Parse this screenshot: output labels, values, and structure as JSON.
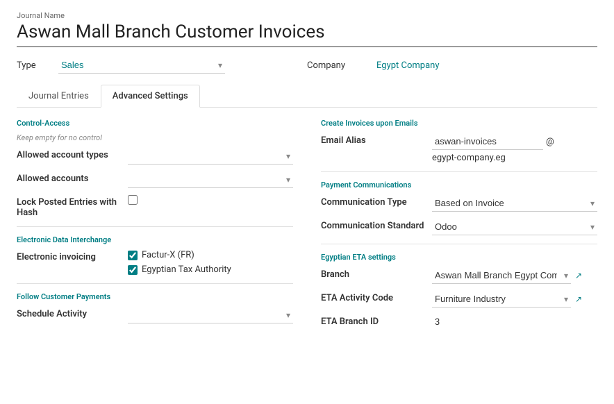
{
  "header": {
    "journal_name_label": "Journal Name",
    "journal_title": "Aswan Mall Branch Customer Invoices"
  },
  "type_row": {
    "type_label": "Type",
    "type_value": "Sales",
    "company_label": "Company",
    "company_value": "Egypt Company"
  },
  "tabs": [
    {
      "id": "journal-entries",
      "label": "Journal Entries",
      "active": false
    },
    {
      "id": "advanced-settings",
      "label": "Advanced Settings",
      "active": true
    }
  ],
  "left_panel": {
    "control_access": {
      "section_title": "Control-Access",
      "subtitle": "Keep empty for no control",
      "allowed_account_types_label": "Allowed account types",
      "allowed_accounts_label": "Allowed accounts",
      "lock_posted_label": "Lock Posted Entries with Hash",
      "lock_posted_checked": false
    },
    "edi": {
      "section_title": "Electronic Data Interchange",
      "electronic_invoicing_label": "Electronic invoicing",
      "options": [
        {
          "label": "Factur-X (FR)",
          "checked": true
        },
        {
          "label": "Egyptian Tax Authority",
          "checked": true
        }
      ]
    },
    "follow_customer": {
      "section_title": "Follow Customer Payments",
      "schedule_activity_label": "Schedule Activity"
    }
  },
  "right_panel": {
    "create_invoices": {
      "section_title": "Create Invoices upon Emails",
      "email_alias_label": "Email Alias",
      "email_alias_value": "aswan-invoices",
      "at_symbol": "@",
      "email_domain": "egypt-company.eg"
    },
    "payment_communications": {
      "section_title": "Payment Communications",
      "communication_type_label": "Communication Type",
      "communication_type_value": "Based on Invoice",
      "communication_standard_label": "Communication Standard",
      "communication_standard_value": "Odoo"
    },
    "eta_settings": {
      "section_title": "Egyptian ETA settings",
      "branch_label": "Branch",
      "branch_value": "Aswan Mall Branch Egypt Company",
      "eta_activity_code_label": "ETA Activity Code",
      "eta_activity_code_value": "Furniture Industry",
      "eta_branch_id_label": "ETA Branch ID",
      "eta_branch_id_value": "3"
    }
  }
}
